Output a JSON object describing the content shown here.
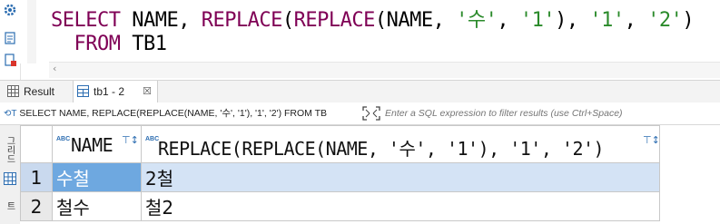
{
  "editor": {
    "line1": [
      {
        "t": "SELECT",
        "cls": "kw"
      },
      {
        "t": " NAME, ",
        "cls": ""
      },
      {
        "t": "REPLACE",
        "cls": "kw"
      },
      {
        "t": "(",
        "cls": ""
      },
      {
        "t": "REPLACE",
        "cls": "kw"
      },
      {
        "t": "(NAME, ",
        "cls": ""
      },
      {
        "t": "'수'",
        "cls": "str"
      },
      {
        "t": ", ",
        "cls": ""
      },
      {
        "t": "'1'",
        "cls": "str"
      },
      {
        "t": "), ",
        "cls": ""
      },
      {
        "t": "'1'",
        "cls": "str"
      },
      {
        "t": ", ",
        "cls": ""
      },
      {
        "t": "'2'",
        "cls": "str"
      },
      {
        "t": ")",
        "cls": ""
      }
    ],
    "line2": [
      {
        "t": "  ",
        "cls": ""
      },
      {
        "t": "FROM",
        "cls": "kw"
      },
      {
        "t": " TB1",
        "cls": ""
      }
    ]
  },
  "tabs": {
    "result_label": "Result",
    "tb1_label": "tb1 - 2",
    "tb1_close": "☒"
  },
  "filter": {
    "query_text": "SELECT NAME, REPLACE(REPLACE(NAME, '수', '1'), '1', '2') FROM TB",
    "placeholder": "Enter a SQL expression to filter results (use Ctrl+Space)"
  },
  "side_panel": {
    "label_top": "그리드",
    "label_bottom": "텍스트"
  },
  "grid": {
    "abc_badge": "ABC",
    "columns": [
      "NAME",
      "REPLACE(REPLACE(NAME, '수', '1'), '1', '2')"
    ],
    "rows": [
      {
        "num": "1",
        "cells": [
          "수철",
          "2철"
        ]
      },
      {
        "num": "2",
        "cells": [
          "철수",
          "철2"
        ]
      }
    ]
  },
  "colors": {
    "keyword": "#7f0055",
    "string": "#2a8a2a",
    "selection": "#6ea8e0",
    "accent": "#2c6db1"
  }
}
